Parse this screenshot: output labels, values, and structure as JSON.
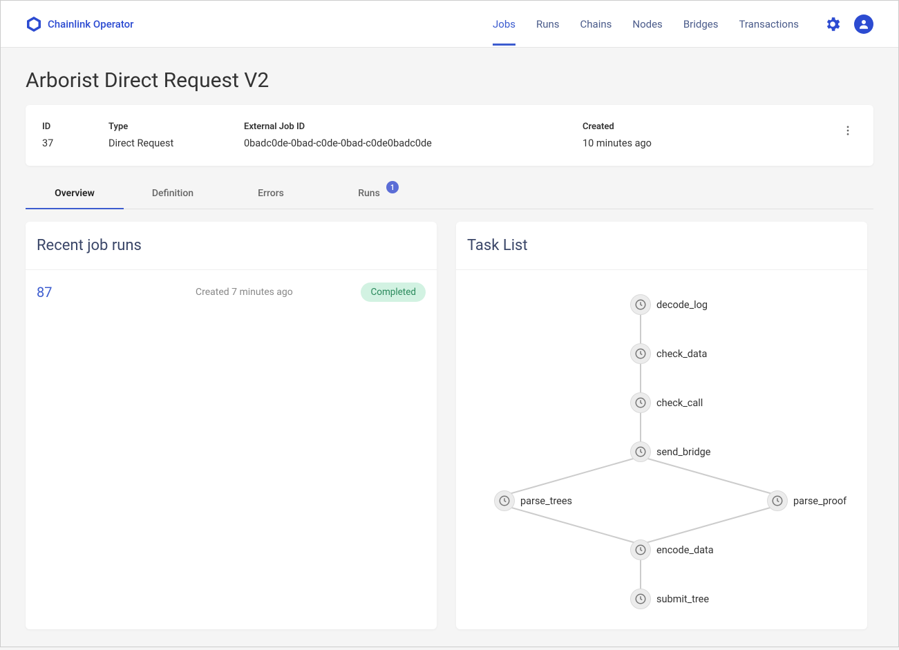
{
  "brand": "Chainlink Operator",
  "nav": {
    "jobs": "Jobs",
    "runs": "Runs",
    "chains": "Chains",
    "nodes": "Nodes",
    "bridges": "Bridges",
    "transactions": "Transactions"
  },
  "page": {
    "title": "Arborist Direct Request V2"
  },
  "info": {
    "id_label": "ID",
    "id_value": "37",
    "type_label": "Type",
    "type_value": "Direct Request",
    "ext_label": "External Job ID",
    "ext_value": "0badc0de-0bad-c0de-0bad-c0de0badc0de",
    "created_label": "Created",
    "created_value": "10 minutes ago"
  },
  "tabs": {
    "overview": "Overview",
    "definition": "Definition",
    "errors": "Errors",
    "runs": "Runs",
    "runs_badge": "1"
  },
  "recent_runs": {
    "title": "Recent job runs",
    "row": {
      "id": "87",
      "created": "Created 7 minutes ago",
      "status": "Completed"
    }
  },
  "task_list": {
    "title": "Task List",
    "nodes": {
      "decode_log": "decode_log",
      "check_data": "check_data",
      "check_call": "check_call",
      "send_bridge": "send_bridge",
      "parse_trees": "parse_trees",
      "parse_proof": "parse_proof",
      "encode_data": "encode_data",
      "submit_tree": "submit_tree"
    }
  }
}
